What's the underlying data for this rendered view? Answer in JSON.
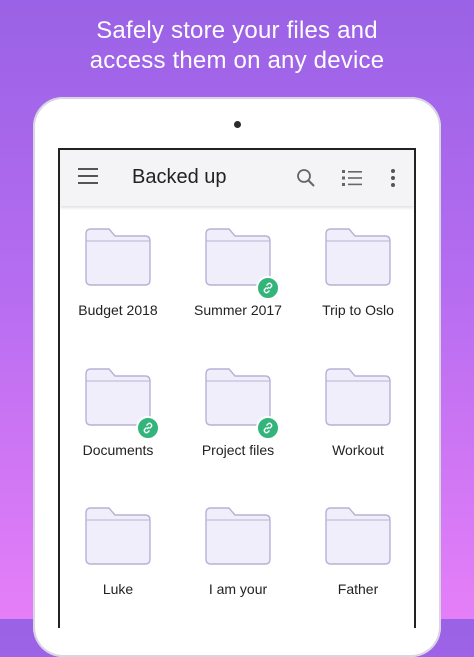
{
  "tagline": {
    "line1": "Safely store your files and",
    "line2": "access them on any device"
  },
  "appbar": {
    "title": "Backed up",
    "icons": [
      "menu-icon",
      "search-icon",
      "list-view-icon",
      "more-vert-icon"
    ]
  },
  "folders": [
    {
      "name": "Budget 2018",
      "shared": false
    },
    {
      "name": "Summer 2017",
      "shared": true
    },
    {
      "name": "Trip to Oslo",
      "shared": false
    },
    {
      "name": "Documents",
      "shared": true
    },
    {
      "name": "Project files",
      "shared": true
    },
    {
      "name": "Workout",
      "shared": false
    },
    {
      "name": "Luke",
      "shared": false
    },
    {
      "name": "I am your",
      "shared": false
    },
    {
      "name": "Father",
      "shared": false
    }
  ],
  "colors": {
    "background_top": "#9a62e6",
    "background_bottom": "#e57ff8",
    "folder_fill": "#f1eefb",
    "folder_stroke": "#b8b1d6",
    "shared_badge": "#32b47a"
  }
}
